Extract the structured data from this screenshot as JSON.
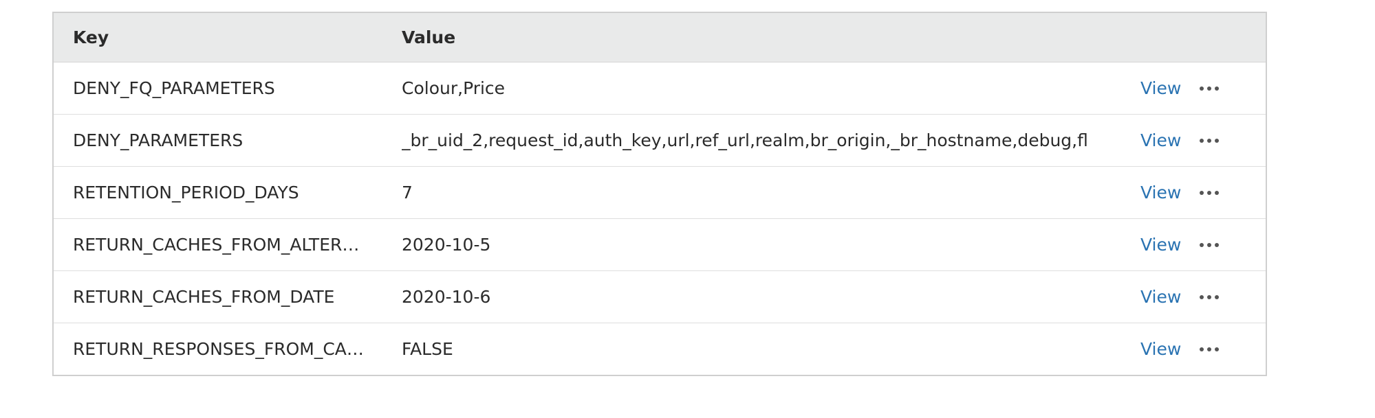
{
  "table": {
    "headers": {
      "key": "Key",
      "value": "Value"
    },
    "rows": [
      {
        "key": "DENY_FQ_PARAMETERS",
        "value": "Colour,Price",
        "action": "View"
      },
      {
        "key": "DENY_PARAMETERS",
        "value": "_br_uid_2,request_id,auth_key,url,ref_url,realm,br_origin,_br_hostname,debug,fl",
        "action": "View"
      },
      {
        "key": "RETENTION_PERIOD_DAYS",
        "value": "7",
        "action": "View"
      },
      {
        "key": "RETURN_CACHES_FROM_ALTER…",
        "value": "2020-10-5",
        "action": "View"
      },
      {
        "key": "RETURN_CACHES_FROM_DATE",
        "value": "2020-10-6",
        "action": "View"
      },
      {
        "key": "RETURN_RESPONSES_FROM_CA…",
        "value": "FALSE",
        "action": "View"
      }
    ]
  },
  "icons": {
    "row_menu": "more-horizontal-icon"
  },
  "colors": {
    "link": "#2a73b2",
    "header_bg": "#e9eaea",
    "border": "#cfcfcf"
  }
}
